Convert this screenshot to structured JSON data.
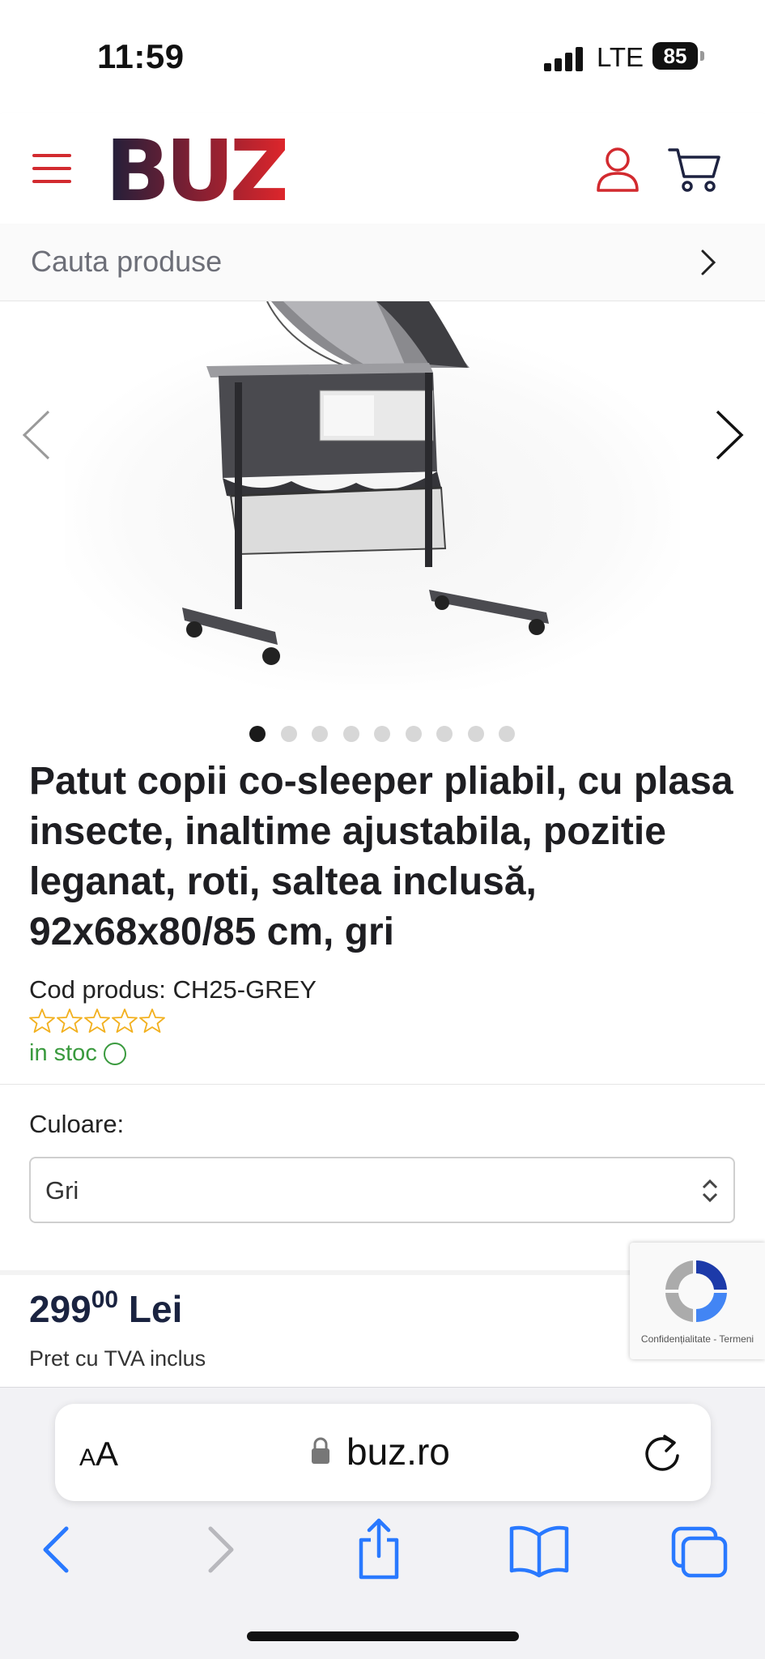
{
  "status_bar": {
    "time": "11:59",
    "network": "LTE",
    "battery": "85"
  },
  "header": {
    "logo_text": "BUZ",
    "menu_icon": "hamburger-icon",
    "account_icon": "user-icon",
    "cart_icon": "cart-icon",
    "brand_color": "#d22a2f"
  },
  "search": {
    "placeholder": "Cauta produse"
  },
  "gallery": {
    "image_count": 9,
    "active_index": 0
  },
  "product": {
    "title": "Patut copii co-sleeper pliabil, cu plasa insecte, inaltime ajustabila, pozitie leganat, roti, saltea inclusă, 92x68x80/85 cm, gri",
    "code": "Cod produs: CH25-GREY",
    "rating": 0,
    "rating_max": 5,
    "stock": "in stoc",
    "color_label": "Culoare:",
    "color_value": "Gri",
    "price_int": "299",
    "price_dec": "00",
    "currency": "Lei",
    "price_note": "Pret cu TVA inclus"
  },
  "recaptcha": {
    "text": "Confidențialitate - Termeni"
  },
  "browser": {
    "aa_small": "A",
    "aa_big": "A",
    "url": "buz.ro"
  }
}
